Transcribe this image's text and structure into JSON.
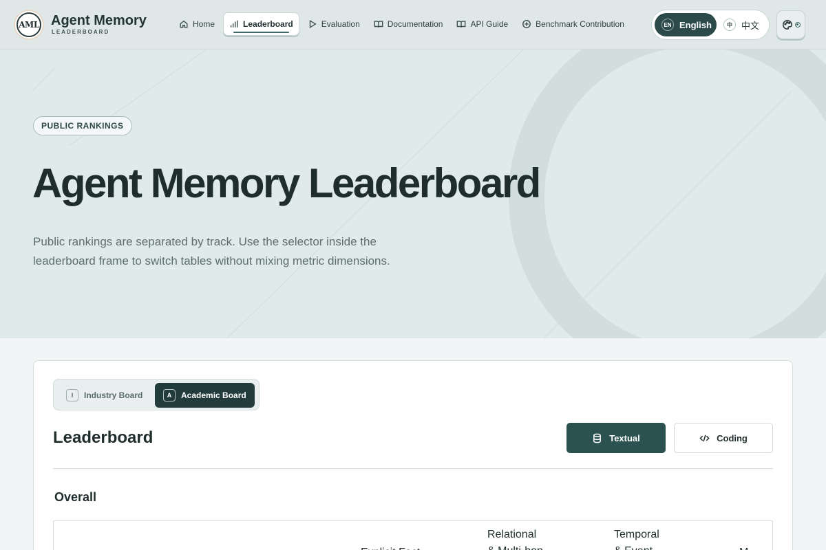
{
  "brand": {
    "logo_text": "AML",
    "title": "Agent Memory",
    "subtitle": "LEADERBOARD"
  },
  "nav": {
    "items": [
      {
        "label": "Home",
        "icon": "home-icon"
      },
      {
        "label": "Leaderboard",
        "icon": "bar-chart-icon",
        "active": true
      },
      {
        "label": "Evaluation",
        "icon": "play-icon"
      },
      {
        "label": "Documentation",
        "icon": "book-icon"
      },
      {
        "label": "API Guide",
        "icon": "book-icon"
      },
      {
        "label": "Benchmark Contribution",
        "icon": "plus-circle-icon"
      }
    ]
  },
  "language": {
    "en_badge": "EN",
    "en_label": "English",
    "zh_badge": "中",
    "zh_label": "中文",
    "selected": "English"
  },
  "theme_button": {
    "icon": "palette-icon"
  },
  "hero": {
    "eyebrow": "PUBLIC RANKINGS",
    "title": "Agent Memory Leaderboard",
    "description": "Public rankings are separated by track. Use the selector inside the leaderboard frame to switch tables without mixing metric dimensions."
  },
  "board_toggle": {
    "industry_badge": "I",
    "industry_label": "Industry Board",
    "academic_badge": "A",
    "academic_label": "Academic Board",
    "selected": "Academic Board"
  },
  "leaderboard": {
    "title": "Leaderboard",
    "tracks": [
      {
        "label": "Textual",
        "icon": "database-icon",
        "selected": true
      },
      {
        "label": "Coding",
        "icon": "code-icon",
        "selected": false
      }
    ],
    "section_title": "Overall",
    "column_headers": [
      {
        "lines": [
          "",
          "Explicit Fact"
        ]
      },
      {
        "lines": [
          "Relational",
          "& Multi-hop"
        ]
      },
      {
        "lines": [
          "Temporal",
          "& Event"
        ]
      },
      {
        "lines": [
          "",
          "M"
        ]
      }
    ]
  },
  "colors": {
    "accent": "#2b5250",
    "header_bg": "#dfe8e7",
    "hero_bg": "#e0eaea",
    "page_bg": "#f1f5f5"
  }
}
